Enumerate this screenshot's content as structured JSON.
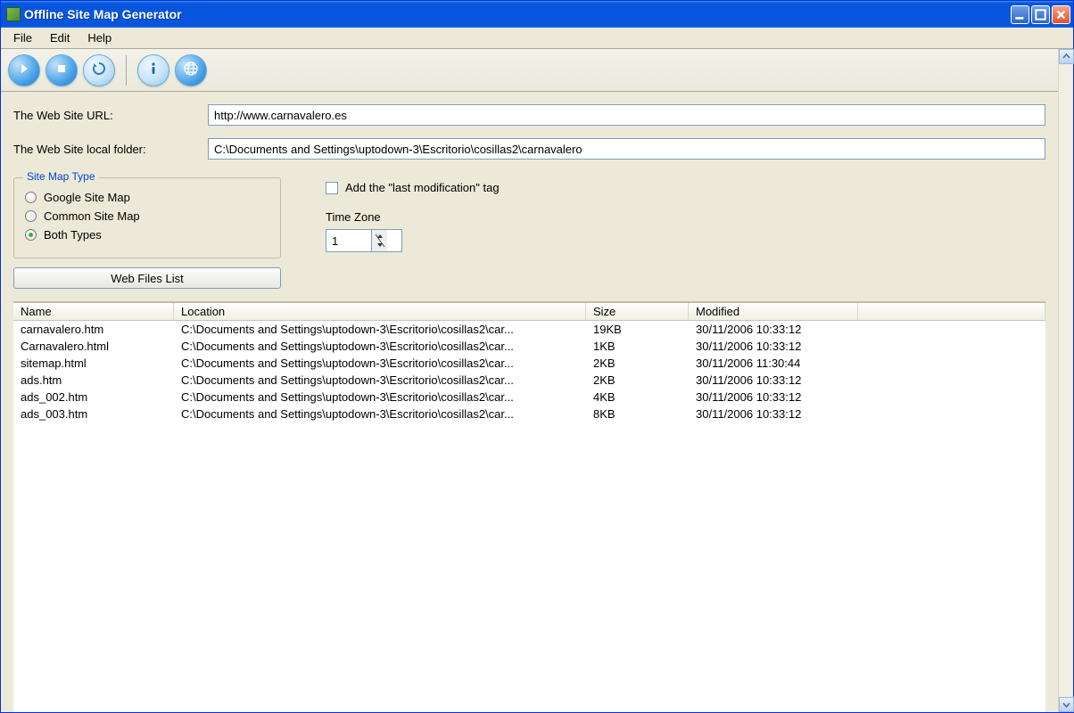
{
  "window": {
    "title": "Offline Site Map Generator"
  },
  "menu": {
    "file": "File",
    "edit": "Edit",
    "help": "Help"
  },
  "toolbar": {
    "play": "play-icon",
    "stop": "stop-icon",
    "refresh": "refresh-icon",
    "info": "info-icon",
    "globe": "globe-icon"
  },
  "form": {
    "url_label": "The Web Site URL:",
    "url_value": "http://www.carnavalero.es",
    "folder_label": "The Web Site local folder:",
    "folder_value": "C:\\Documents and Settings\\uptodown-3\\Escritorio\\cosillas2\\carnavalero"
  },
  "sitemap": {
    "group_title": "Site Map Type",
    "opt_google": "Google Site Map",
    "opt_common": "Common Site Map",
    "opt_both": "Both Types",
    "selected": "both"
  },
  "options": {
    "lastmod_label": "Add the \"last modification\" tag",
    "tz_label": "Time Zone",
    "tz_value": "1"
  },
  "buttons": {
    "web_files_list": "Web Files List"
  },
  "list": {
    "columns": {
      "name": "Name",
      "location": "Location",
      "size": "Size",
      "modified": "Modified"
    },
    "rows": [
      {
        "name": "carnavalero.htm",
        "location": "C:\\Documents and Settings\\uptodown-3\\Escritorio\\cosillas2\\car...",
        "size": "19KB",
        "modified": "30/11/2006 10:33:12"
      },
      {
        "name": "Carnavalero.html",
        "location": "C:\\Documents and Settings\\uptodown-3\\Escritorio\\cosillas2\\car...",
        "size": "1KB",
        "modified": "30/11/2006 10:33:12"
      },
      {
        "name": "sitemap.html",
        "location": "C:\\Documents and Settings\\uptodown-3\\Escritorio\\cosillas2\\car...",
        "size": "2KB",
        "modified": "30/11/2006 11:30:44"
      },
      {
        "name": "ads.htm",
        "location": "C:\\Documents and Settings\\uptodown-3\\Escritorio\\cosillas2\\car...",
        "size": "2KB",
        "modified": "30/11/2006 10:33:12"
      },
      {
        "name": "ads_002.htm",
        "location": "C:\\Documents and Settings\\uptodown-3\\Escritorio\\cosillas2\\car...",
        "size": "4KB",
        "modified": "30/11/2006 10:33:12"
      },
      {
        "name": "ads_003.htm",
        "location": "C:\\Documents and Settings\\uptodown-3\\Escritorio\\cosillas2\\car...",
        "size": "8KB",
        "modified": "30/11/2006 10:33:12"
      }
    ]
  }
}
